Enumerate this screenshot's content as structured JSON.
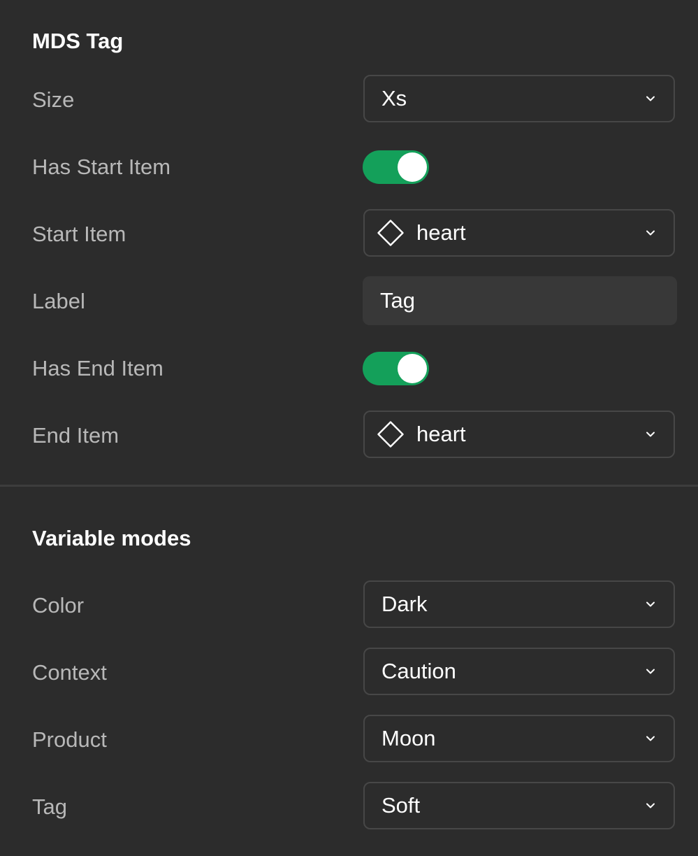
{
  "component": {
    "title": "MDS Tag",
    "size": {
      "label": "Size",
      "value": "Xs"
    },
    "has_start_item": {
      "label": "Has Start Item",
      "on": true
    },
    "start_item": {
      "label": "Start Item",
      "value": "heart",
      "icon": "diamond-component-icon"
    },
    "label_field": {
      "label": "Label",
      "value": "Tag"
    },
    "has_end_item": {
      "label": "Has End Item",
      "on": true
    },
    "end_item": {
      "label": "End Item",
      "value": "heart",
      "icon": "diamond-component-icon"
    }
  },
  "variable_modes": {
    "title": "Variable modes",
    "color": {
      "label": "Color",
      "value": "Dark"
    },
    "context": {
      "label": "Context",
      "value": "Caution"
    },
    "product": {
      "label": "Product",
      "value": "Moon"
    },
    "tag": {
      "label": "Tag",
      "value": "Soft"
    }
  },
  "colors": {
    "background": "#2c2c2c",
    "toggle_on": "#14a05a",
    "border": "#474747",
    "input_bg": "#383838",
    "label_text": "#b8b8b8"
  }
}
